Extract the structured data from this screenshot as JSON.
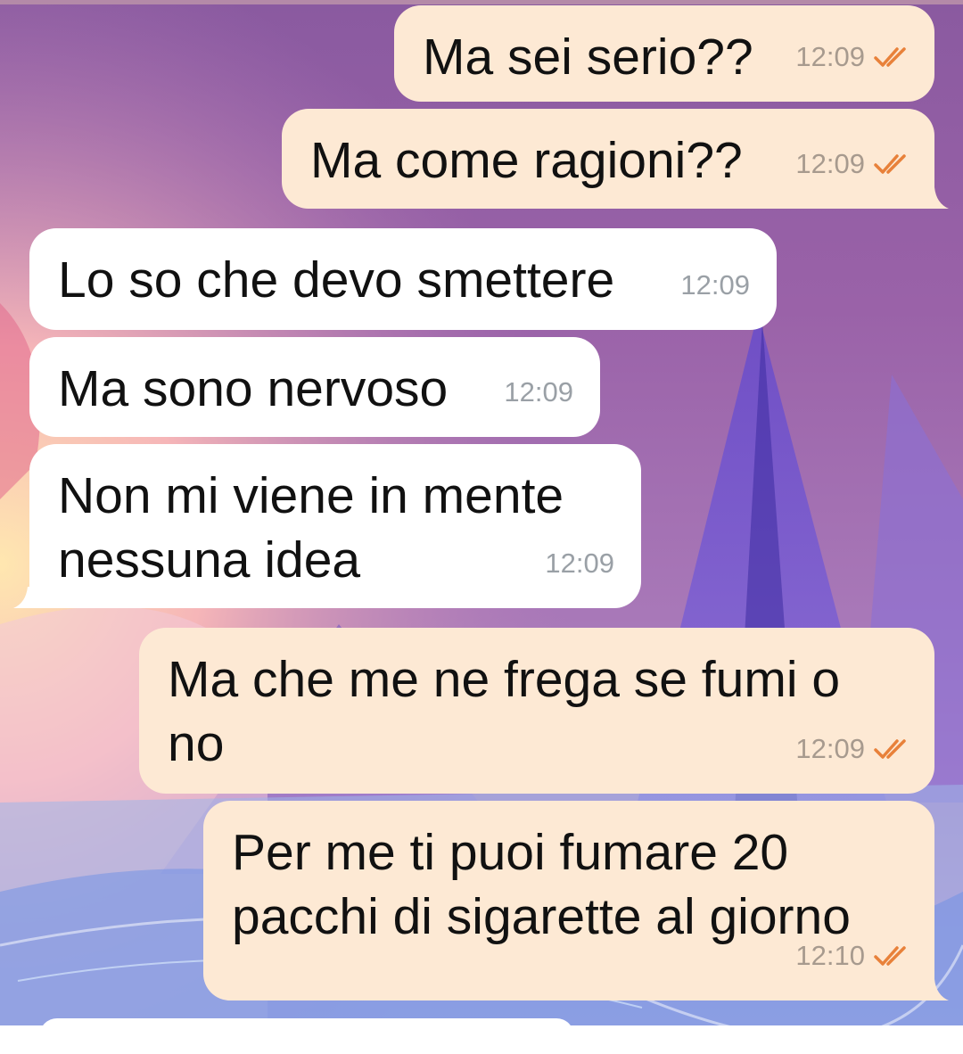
{
  "messages": [
    {
      "side": "out",
      "text": "Ma sei serio??",
      "time": "12:09",
      "status": "read-double-check-icon"
    },
    {
      "side": "out",
      "text": "Ma come ragioni??",
      "time": "12:09",
      "status": "read-double-check-icon"
    },
    {
      "side": "in",
      "text": "Lo so che devo smettere",
      "time": "12:09"
    },
    {
      "side": "in",
      "text": "Ma sono nervoso",
      "time": "12:09"
    },
    {
      "side": "in",
      "text": "Non mi viene in mente\nnessuna idea",
      "time": "12:09"
    },
    {
      "side": "out",
      "text": "Ma che me ne frega se fumi o\nno",
      "time": "12:09",
      "status": "read-double-check-icon"
    },
    {
      "side": "out",
      "text": "Per me ti puoi fumare 20\npacchi di sigarette al giorno",
      "time": "12:10",
      "status": "read-double-check-icon"
    }
  ],
  "colors": {
    "outgoing_bubble": "#fde9d4",
    "incoming_bubble": "#ffffff",
    "check_marks": "#e8813a",
    "time_text": "#a79a8e"
  }
}
